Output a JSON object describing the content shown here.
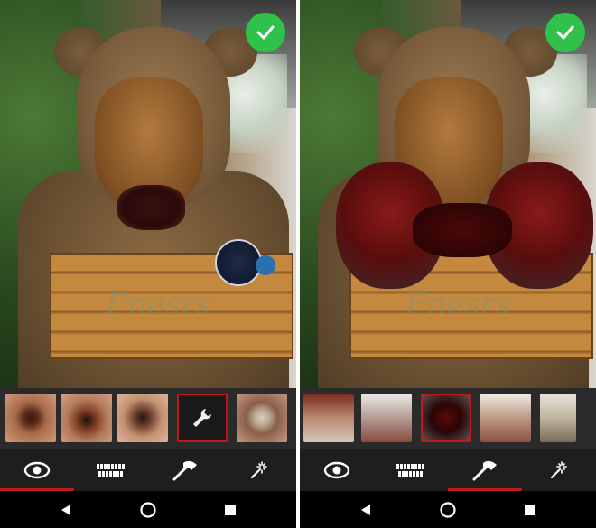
{
  "panels": [
    {
      "id": "left",
      "sign_text": "Fnesrs",
      "thumbnails": [
        "zombie-eye-1",
        "zombie-eye-2",
        "zombie-eye-3",
        "wrench-tool",
        "zombie-eye-4"
      ],
      "selected_thumbnail": 3,
      "selected_tab": 0
    },
    {
      "id": "right",
      "sign_text": "Fnesrs",
      "thumbnails": [
        "zombie-head-knife",
        "zombie-face-blade",
        "bloody-hands",
        "zombie-eye-blade",
        "zombie-face"
      ],
      "selected_thumbnail": 2,
      "selected_tab": 2
    }
  ],
  "tabs": [
    {
      "icon": "eye-icon"
    },
    {
      "icon": "teeth-icon"
    },
    {
      "icon": "axe-icon"
    },
    {
      "icon": "magic-wand-icon"
    }
  ],
  "nav": [
    {
      "icon": "back-icon"
    },
    {
      "icon": "home-icon"
    },
    {
      "icon": "recents-icon"
    }
  ],
  "colors": {
    "accent": "#c0171a",
    "confirm": "#2fc14a",
    "toolbar_bg": "#1e1e1e",
    "strip_bg": "#2a2a2a"
  }
}
